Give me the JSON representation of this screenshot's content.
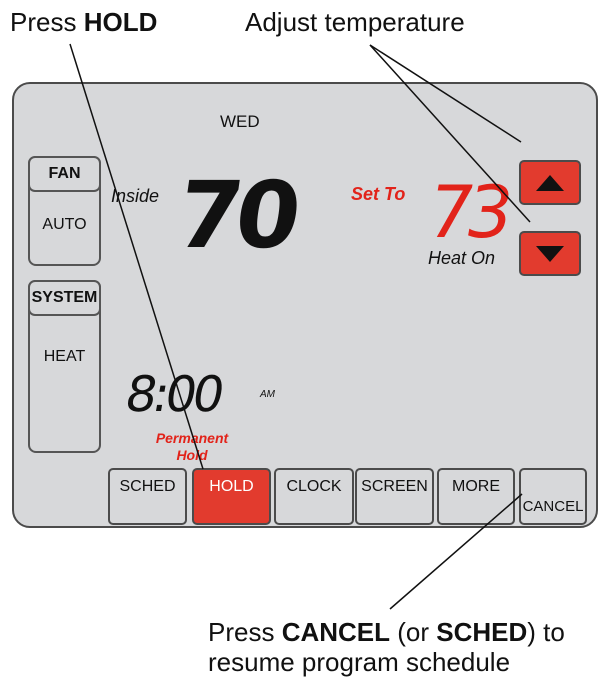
{
  "callouts": {
    "hold": {
      "prefix": "Press ",
      "strong": "HOLD"
    },
    "adjust": {
      "text": "Adjust temperature"
    },
    "cancel": {
      "line1_prefix": "Press ",
      "line1_strong_1": "CANCEL",
      "line1_mid": " (or ",
      "line1_strong_2": "SCHED",
      "line1_suffix": ") to",
      "line2": "resume program schedule"
    }
  },
  "thermostat": {
    "day": "WED",
    "fan": {
      "label": "FAN",
      "value": "AUTO"
    },
    "system": {
      "label": "SYSTEM",
      "value": "HEAT"
    },
    "inside_label": "Inside",
    "inside_temperature": "70",
    "set_to_label": "Set To",
    "set_temperature": "73",
    "heat_status": "Heat On",
    "time": "8:00",
    "meridiem": "AM",
    "hold_status_line1": "Permanent",
    "hold_status_line2": "Hold",
    "buttons": {
      "sched": "SCHED",
      "hold": "HOLD",
      "clock": "CLOCK",
      "screen": "SCREEN",
      "more": "MORE",
      "cancel": "CANCEL"
    },
    "icons": {
      "up": "up-arrow-icon",
      "down": "down-arrow-icon"
    },
    "colors": {
      "accent_red": "#e23b2e",
      "display_red": "#e2231a",
      "screen_gray": "#d7d8da",
      "border_dark": "#4b4b4b"
    }
  }
}
